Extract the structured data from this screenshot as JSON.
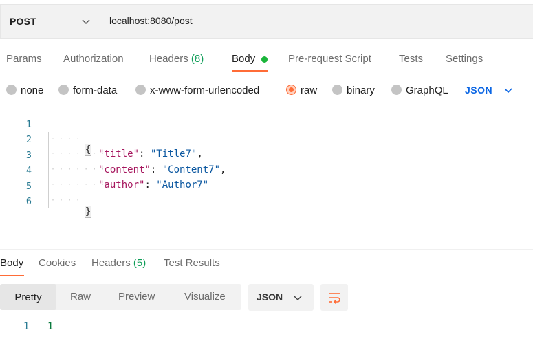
{
  "request": {
    "method": "POST",
    "url": "localhost:8080/post"
  },
  "request_tabs": [
    {
      "label": "Params"
    },
    {
      "label": "Authorization"
    },
    {
      "label": "Headers",
      "count": "(8)"
    },
    {
      "label": "Body",
      "active": true
    },
    {
      "label": "Pre-request Script"
    },
    {
      "label": "Tests"
    },
    {
      "label": "Settings"
    }
  ],
  "body_types": [
    {
      "label": "none"
    },
    {
      "label": "form-data"
    },
    {
      "label": "x-www-form-urlencoded"
    },
    {
      "label": "raw",
      "selected": true
    },
    {
      "label": "binary"
    },
    {
      "label": "GraphQL"
    }
  ],
  "body_format": "JSON",
  "editor": {
    "line_numbers": [
      "1",
      "2",
      "3",
      "4",
      "5",
      "6"
    ],
    "open_brace": "{",
    "close_brace": "}",
    "fields": [
      {
        "key": "\"title\"",
        "value": "\"Title7\"",
        "trail": ","
      },
      {
        "key": "\"content\"",
        "value": "\"Content7\"",
        "trail": ","
      },
      {
        "key": "\"author\"",
        "value": "\"Author7\"",
        "trail": ""
      }
    ]
  },
  "response_tabs": [
    {
      "label": "Body",
      "active": true
    },
    {
      "label": "Cookies"
    },
    {
      "label": "Headers",
      "count": "(5)"
    },
    {
      "label": "Test Results"
    }
  ],
  "view_modes": [
    "Pretty",
    "Raw",
    "Preview",
    "Visualize"
  ],
  "response_format": "JSON",
  "response": {
    "line_number": "1",
    "value": "1"
  },
  "colors": {
    "accent": "#ff6c37",
    "link_blue": "#0b66e4",
    "count_green": "#0f9d58",
    "body_dot": "#1ab53a"
  },
  "icons": {
    "method_dropdown": "chevron-down-icon",
    "format_dropdown": "chevron-down-icon",
    "wrap": "wrap-lines-icon"
  }
}
